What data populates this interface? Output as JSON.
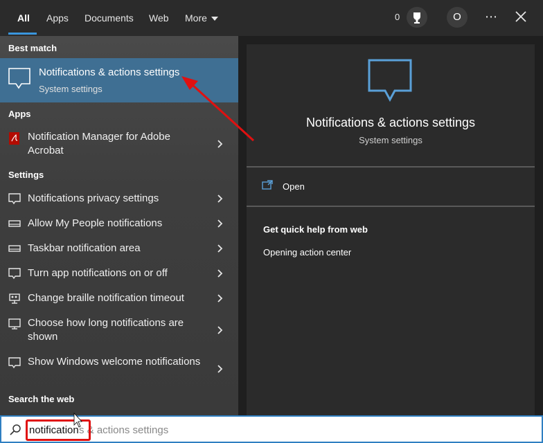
{
  "tabs": [
    {
      "label": "All",
      "active": true
    },
    {
      "label": "Apps"
    },
    {
      "label": "Documents"
    },
    {
      "label": "Web"
    },
    {
      "label": "More"
    }
  ],
  "header": {
    "points": "0",
    "avatar_initial": "O",
    "more_options": "⋯",
    "icons": [
      "trophy-icon",
      "close-icon"
    ]
  },
  "best_match": {
    "section": "Best match",
    "title": "Notifications & actions settings",
    "subtitle": "System settings"
  },
  "apps": {
    "section": "Apps",
    "items": [
      {
        "label": "Notification Manager for Adobe Acrobat",
        "icon": "acrobat-icon"
      }
    ]
  },
  "settings": {
    "section": "Settings",
    "items": [
      {
        "label": "Notifications privacy settings",
        "icon": "speech-bubble-icon"
      },
      {
        "label": "Allow My People notifications",
        "icon": "taskbar-icon"
      },
      {
        "label": "Taskbar notification area",
        "icon": "taskbar-icon"
      },
      {
        "label": "Turn app notifications on or off",
        "icon": "speech-bubble-icon"
      },
      {
        "label": "Change braille notification timeout",
        "icon": "braille-icon"
      },
      {
        "label": "Choose how long notifications are shown",
        "icon": "monitor-icon"
      },
      {
        "label": "Show Windows welcome notifications",
        "icon": "speech-bubble-icon"
      }
    ]
  },
  "web": {
    "section": "Search the web"
  },
  "preview": {
    "title": "Notifications & actions settings",
    "subtitle": "System settings",
    "open_label": "Open",
    "help_heading": "Get quick help from web",
    "help_link": "Opening action center"
  },
  "search": {
    "typed": "notification",
    "suggestion": "s & actions settings"
  },
  "colors": {
    "accent": "#3a96dd",
    "selected_bg": "#3f6f93",
    "annotation": "#e01010"
  }
}
